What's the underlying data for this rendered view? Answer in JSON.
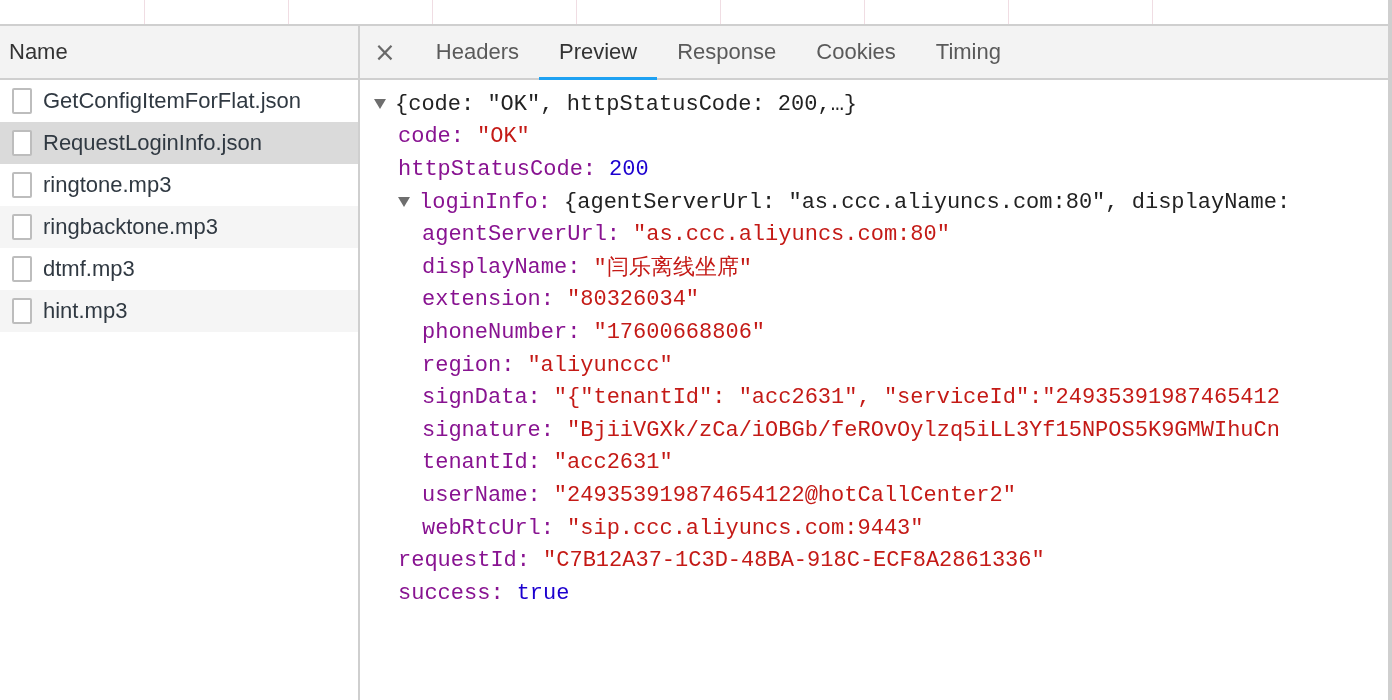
{
  "sidebar": {
    "header": "Name",
    "items": [
      {
        "name": "GetConfigItemForFlat.json",
        "selected": false
      },
      {
        "name": "RequestLoginInfo.json",
        "selected": true
      },
      {
        "name": "ringtone.mp3",
        "selected": false
      },
      {
        "name": "ringbacktone.mp3",
        "selected": false
      },
      {
        "name": "dtmf.mp3",
        "selected": false
      },
      {
        "name": "hint.mp3",
        "selected": false
      }
    ]
  },
  "tabs": {
    "close": "×",
    "items": [
      {
        "label": "Headers",
        "selected": false
      },
      {
        "label": "Preview",
        "selected": true
      },
      {
        "label": "Response",
        "selected": false
      },
      {
        "label": "Cookies",
        "selected": false
      },
      {
        "label": "Timing",
        "selected": false
      }
    ]
  },
  "preview": {
    "kind": "object",
    "summary": "{code: \"OK\", httpStatusCode: 200,…}",
    "expanded": true,
    "children": [
      {
        "key": "code:",
        "kind": "string",
        "value": "\"OK\""
      },
      {
        "key": "httpStatusCode:",
        "kind": "number",
        "value": "200"
      },
      {
        "key": "loginInfo:",
        "kind": "object",
        "summary": "{agentServerUrl: \"as.ccc.aliyuncs.com:80\", displayName: ",
        "expanded": true,
        "children": [
          {
            "key": "agentServerUrl:",
            "kind": "string",
            "value": "\"as.ccc.aliyuncs.com:80\""
          },
          {
            "key": "displayName:",
            "kind": "string",
            "value": "\"闫乐离线坐席\""
          },
          {
            "key": "extension:",
            "kind": "string",
            "value": "\"80326034\""
          },
          {
            "key": "phoneNumber:",
            "kind": "string",
            "value": "\"17600668806\""
          },
          {
            "key": "region:",
            "kind": "string",
            "value": "\"aliyunccc\""
          },
          {
            "key": "signData:",
            "kind": "string",
            "value": "\"{\"tenantId\": \"acc2631\", \"serviceId\":\"24935391987465412"
          },
          {
            "key": "signature:",
            "kind": "string",
            "value": "\"BjiiVGXk/zCa/iOBGb/feROvOylzq5iLL3Yf15NPOS5K9GMWIhuCn"
          },
          {
            "key": "tenantId:",
            "kind": "string",
            "value": "\"acc2631\""
          },
          {
            "key": "userName:",
            "kind": "string",
            "value": "\"249353919874654122@hotCallCenter2\""
          },
          {
            "key": "webRtcUrl:",
            "kind": "string",
            "value": "\"sip.ccc.aliyuncs.com:9443\""
          }
        ]
      },
      {
        "key": "requestId:",
        "kind": "string",
        "value": "\"C7B12A37-1C3D-48BA-918C-ECF8A2861336\""
      },
      {
        "key": "success:",
        "kind": "boolean",
        "value": "true"
      }
    ]
  }
}
